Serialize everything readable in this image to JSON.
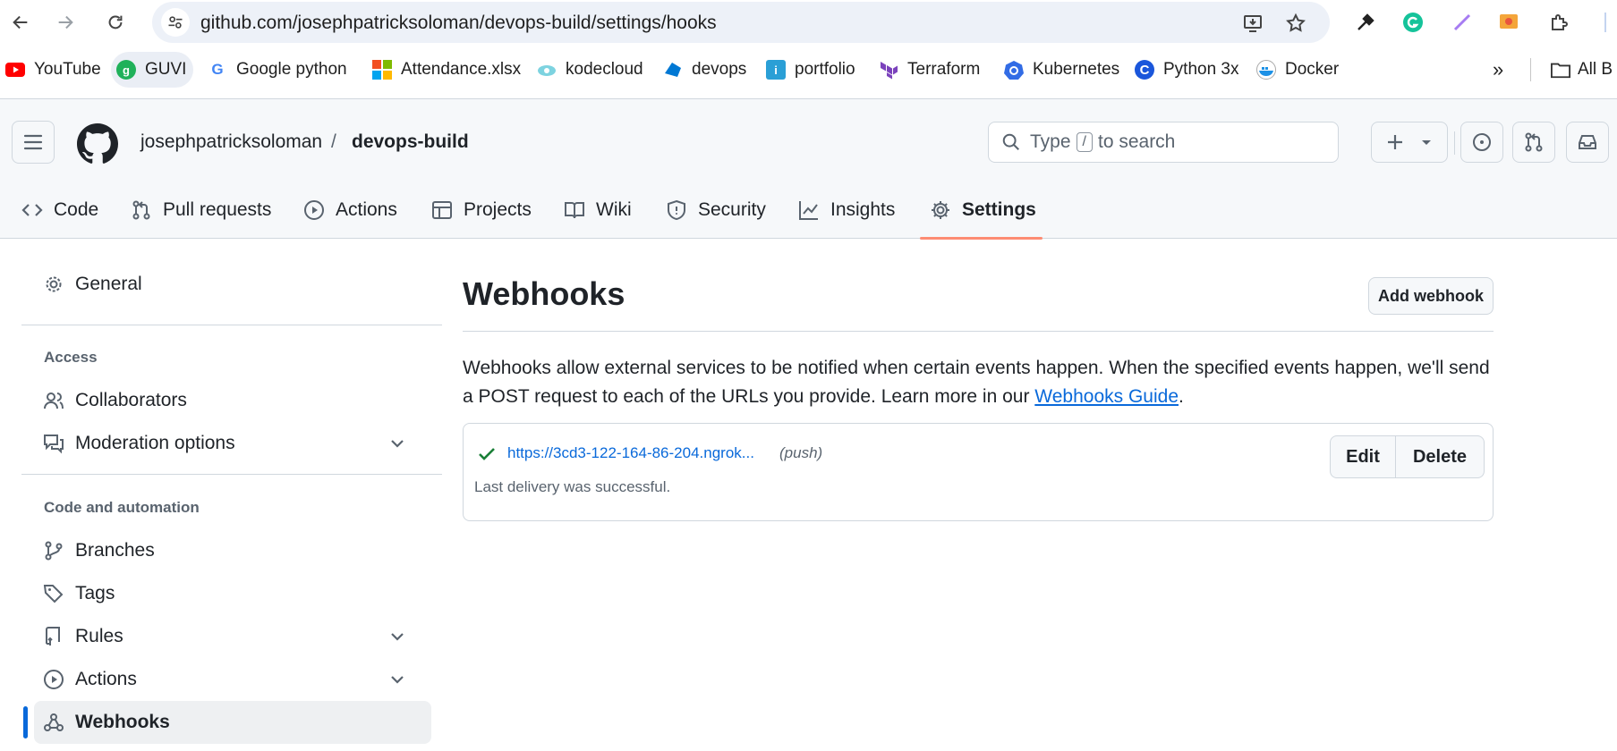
{
  "browser": {
    "url": "github.com/josephpatricksoloman/devops-build/settings/hooks",
    "bookmarks": [
      {
        "label": "YouTube",
        "icon": "youtube-icon"
      },
      {
        "label": "GUVI",
        "icon": "guvi-icon"
      },
      {
        "label": "Google python",
        "icon": "google-icon"
      },
      {
        "label": "Attendance.xlsx",
        "icon": "microsoft-icon"
      },
      {
        "label": "kodecloud",
        "icon": "kodecloud-icon"
      },
      {
        "label": "devops",
        "icon": "devops-icon"
      },
      {
        "label": "portfolio",
        "icon": "portfolio-icon"
      },
      {
        "label": "Terraform",
        "icon": "terraform-icon"
      },
      {
        "label": "Kubernetes",
        "icon": "kubernetes-icon"
      },
      {
        "label": "Python 3x",
        "icon": "python-icon"
      },
      {
        "label": "Docker",
        "icon": "docker-icon"
      }
    ],
    "all_bookmarks_label": "All B"
  },
  "header": {
    "owner": "josephpatricksoloman",
    "separator": "/",
    "repo": "devops-build",
    "search_prefix": "Type",
    "search_key": "/",
    "search_suffix": "to search"
  },
  "tabs": [
    {
      "label": "Code",
      "icon": "code-icon"
    },
    {
      "label": "Pull requests",
      "icon": "pull-request-icon"
    },
    {
      "label": "Actions",
      "icon": "play-icon"
    },
    {
      "label": "Projects",
      "icon": "table-icon"
    },
    {
      "label": "Wiki",
      "icon": "book-icon"
    },
    {
      "label": "Security",
      "icon": "shield-icon"
    },
    {
      "label": "Insights",
      "icon": "graph-icon"
    },
    {
      "label": "Settings",
      "icon": "gear-icon",
      "active": true
    }
  ],
  "sidebar": {
    "general": "General",
    "access_heading": "Access",
    "collaborators": "Collaborators",
    "moderation": "Moderation options",
    "code_heading": "Code and automation",
    "branches": "Branches",
    "tags": "Tags",
    "rules": "Rules",
    "actions": "Actions",
    "webhooks": "Webhooks"
  },
  "main": {
    "title": "Webhooks",
    "add_button": "Add webhook",
    "description": "Webhooks allow external services to be notified when certain events happen. When the specified events happen, we'll send a POST request to each of the URLs you provide. Learn more in our ",
    "guide_link": "Webhooks Guide",
    "description_end": ".",
    "hook": {
      "url": "https://3cd3-122-164-86-204.ngrok...",
      "events": "(push)",
      "status": "Last delivery was successful.",
      "edit": "Edit",
      "delete": "Delete"
    }
  },
  "colors": {
    "accent": "#0969da",
    "tab_underline": "#fd8c73",
    "success": "#1a7f37"
  }
}
